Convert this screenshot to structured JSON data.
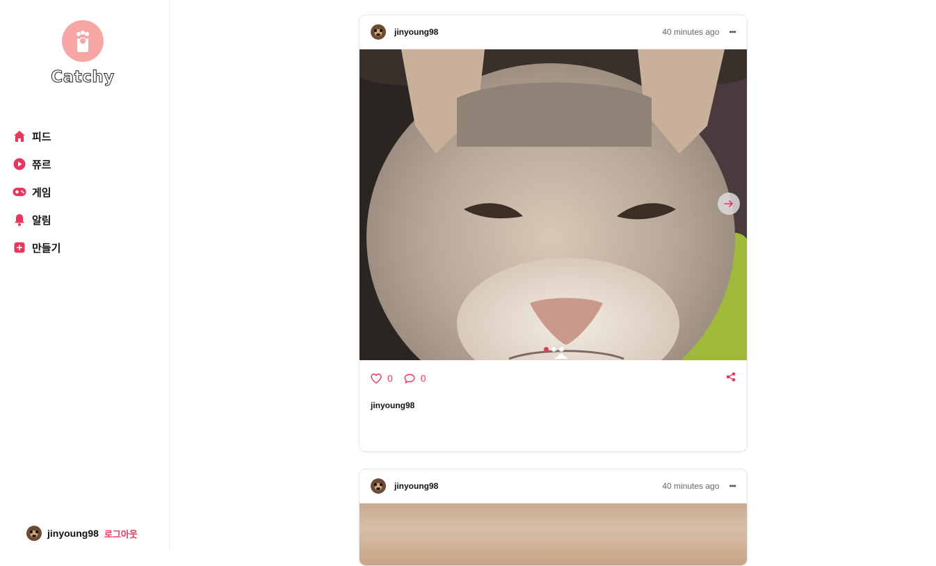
{
  "app": {
    "brand": "Catchy"
  },
  "sidebar": {
    "items": [
      {
        "label": "피드",
        "icon": "home-icon"
      },
      {
        "label": "쮸르",
        "icon": "play-circle-icon"
      },
      {
        "label": "게임",
        "icon": "gamepad-icon"
      },
      {
        "label": "알림",
        "icon": "bell-icon"
      },
      {
        "label": "만들기",
        "icon": "plus-square-icon"
      }
    ],
    "user": {
      "name": "jinyoung98",
      "logout_label": "로그아웃"
    }
  },
  "feed": {
    "posts": [
      {
        "username": "jinyoung98",
        "time": "40 minutes ago",
        "more": "•••",
        "likes": "0",
        "comments": "0",
        "caption": "jinyoung98",
        "image_index": 1,
        "image_count": 3
      },
      {
        "username": "jinyoung98",
        "time": "40 minutes ago",
        "more": "•••"
      }
    ]
  },
  "colors": {
    "accent": "#e8365d",
    "logo_bg": "#f7a5a5",
    "border": "#e6e6e6"
  }
}
